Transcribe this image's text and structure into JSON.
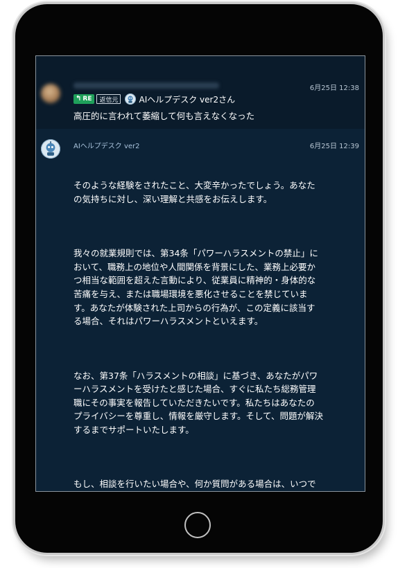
{
  "message_1": {
    "timestamp": "6月25日 12:38",
    "reply_badge": "RE",
    "source_badge": "返信元",
    "reply_to_name": "AIヘルプデスク ver2さん",
    "text": "高圧的に言われて萎縮して何も言えなくなった"
  },
  "message_2": {
    "sender": "AIヘルプデスク ver2",
    "timestamp": "6月25日 12:39",
    "paragraphs": [
      "そのような経験をされたこと、大変辛かったでしょう。あなたの気持ちに対し、深い理解と共感をお伝えします。",
      "我々の就業規則では、第34条「パワーハラスメントの禁止」において、職務上の地位や人間関係を背景にした、業務上必要かつ相当な範囲を超えた言動により、従業員に精神的・身体的な苦痛を与え、または職場環境を悪化させることを禁じています。あなたが体験された上司からの行為が、この定義に該当する場合、それはパワーハラスメントといえます。",
      "なお、第37条「ハラスメントの相談」に基づき、あなたがパワーハラスメントを受けたと感じた場合、すぐに私たち総務管理職にその事実を報告していただきたいです。私たちはあなたのプライバシーを尊重し、情報を厳守します。そして、問題が解決するまでサポートいたします。",
      "もし、相談を行いたい場合や、何か質問がある場合は、いつでもご連絡ください。あなたの安心できる職場環境を守るために、全力で対応いたします。"
    ]
  },
  "icons": {
    "reply": "reply-arrow-icon",
    "bot_avatar": "robot-icon"
  },
  "colors": {
    "screen_bg": "#0c2236",
    "highlight_bg": "#0a1b2b",
    "re_badge": "#1fa05a",
    "sender_name": "#a9c3dc"
  }
}
